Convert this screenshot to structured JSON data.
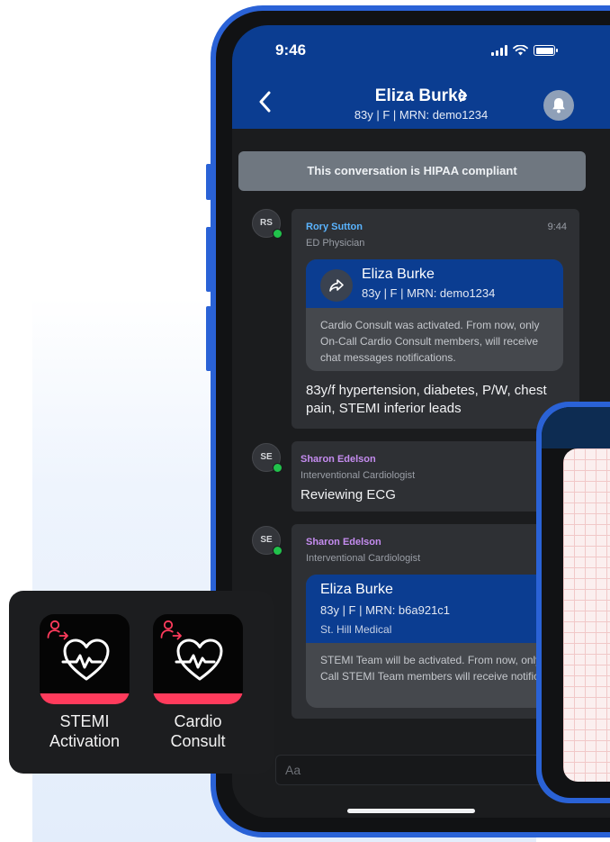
{
  "status_bar": {
    "time": "9:46"
  },
  "header": {
    "patient_name": "Eliza Burke",
    "patient_meta": "83y  |  F  |  MRN: demo1234"
  },
  "banner": {
    "text": "This conversation is HIPAA compliant"
  },
  "messages": [
    {
      "initials": "RS",
      "sender": "Rory Sutton",
      "role": "ED Physician",
      "time": "9:44",
      "card": {
        "name": "Eliza Burke",
        "meta": "83y  |  F  |  MRN: demo1234",
        "text": "Cardio Consult was activated. From now, only On-Call Cardio Consult members, will receive chat messages notifications."
      },
      "body": "83y/f hypertension, diabetes, P/W, chest pain, STEMI inferior leads"
    },
    {
      "initials": "SE",
      "sender": "Sharon Edelson",
      "role": "Interventional Cardiologist",
      "body": "Reviewing ECG"
    },
    {
      "initials": "SE",
      "sender": "Sharon Edelson",
      "role": "Interventional Cardiologist",
      "card": {
        "name": "Eliza Burke",
        "meta": "83y  |  F  |  MRN: b6a921c1",
        "facility": "St. Hill Medical",
        "text": "STEMI Team will be activated. From now, only On-Call STEMI Team members will receive notifications."
      }
    }
  ],
  "composer": {
    "placeholder": "Aa"
  },
  "quick_actions": [
    {
      "label_line1": "STEMI",
      "label_line2": "Activation"
    },
    {
      "label_line1": "Cardio",
      "label_line2": "Consult"
    }
  ],
  "colors": {
    "header_blue": "#0b3d91",
    "frame_blue": "#2a62d6",
    "online_green": "#21c24b",
    "rory_name": "#5ab4ff",
    "sharon_name": "#c58cf0",
    "action_red": "#ff3b5c"
  },
  "icons": [
    "back-chevron-icon",
    "forward-chevron-icon",
    "bell-icon",
    "share-icon",
    "heart-pulse-icon",
    "person-arrow-icon"
  ]
}
